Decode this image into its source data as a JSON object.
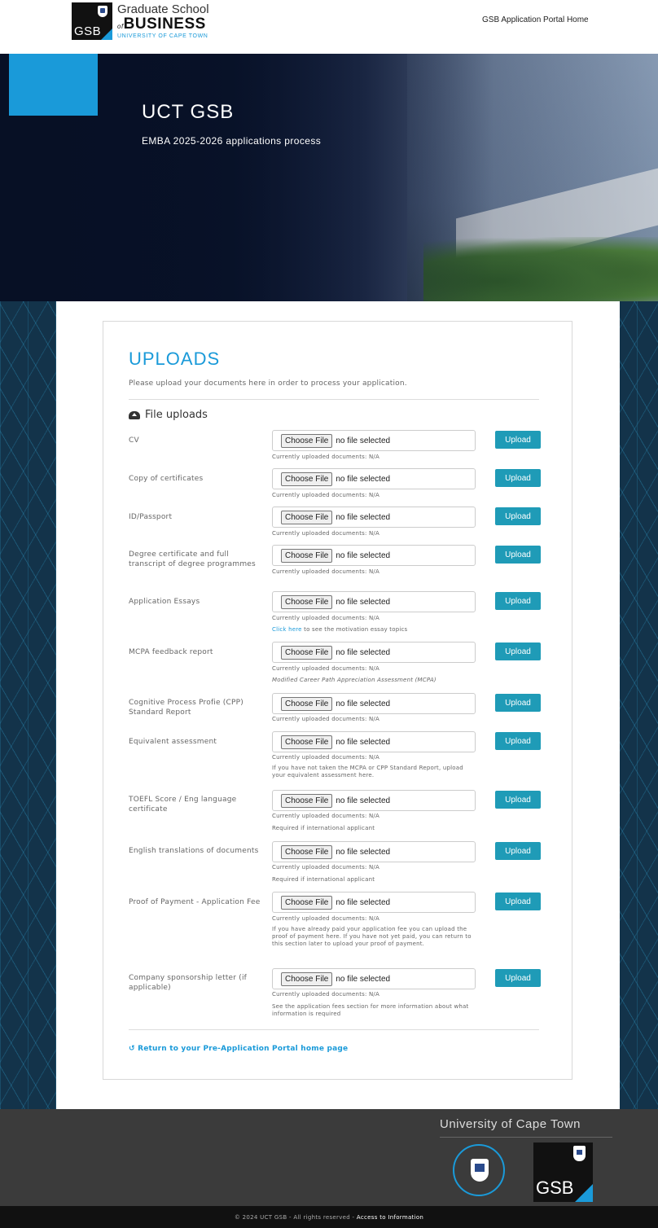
{
  "header": {
    "logo_line1": "Graduate School",
    "logo_of": "of",
    "logo_line2": "BUSINESS",
    "logo_line3": "UNIVERSITY OF CAPE TOWN",
    "logo_gsb": "GSB",
    "portal_home": "GSB Application Portal Home"
  },
  "hero": {
    "title": "UCT GSB",
    "subtitle": "EMBA 2025-2026 applications process"
  },
  "uploads": {
    "title": "UPLOADS",
    "description": "Please upload your documents here in order to process your application.",
    "section_title": "File uploads",
    "choose_label": "Choose File",
    "no_file_label": "no file selected",
    "current_label": "Currently uploaded documents: N/A",
    "upload_label": "Upload",
    "rows": [
      {
        "label": "CV"
      },
      {
        "label": "Copy of certificates"
      },
      {
        "label": "ID/Passport"
      },
      {
        "label": "Degree certificate and full transcript of degree programmes"
      },
      {
        "label": "Application Essays",
        "note_link": "Click here",
        "note": "to see the motivation essay topics"
      },
      {
        "label": "MCPA feedback report",
        "note": "Modified Career Path Appreciation Assessment (MCPA)"
      },
      {
        "label": "Cognitive Process Profie (CPP) Standard Report"
      },
      {
        "label": "Equivalent assessment",
        "note": "If you have not taken the MCPA or CPP Standard Report, upload your equivalent assessment here."
      },
      {
        "label": "TOEFL Score / Eng language certificate",
        "note": "Required if international applicant"
      },
      {
        "label": "English translations of documents",
        "note": "Required if international applicant"
      },
      {
        "label": "Proof of Payment - Application Fee",
        "note": "If you have already paid your application fee you can upload the proof of payment here. If you have not yet paid, you can return to this section later to upload your proof of payment."
      },
      {
        "label": "Company sponsorship letter (if applicable)",
        "note": "See the application fees section for more information about what information is required"
      }
    ],
    "return_link": "Return to your Pre-Application Portal home page"
  },
  "footer": {
    "university": "University of Cape Town",
    "gsb": "GSB",
    "copyright": "© 2024 UCT GSB - All rights reserved -",
    "access_link": "Access to Information"
  },
  "colors": {
    "accent": "#1a9ad9",
    "upload_button": "#1f9bb7",
    "hero_dark": "#071025",
    "footer": "#3b3b3b"
  }
}
